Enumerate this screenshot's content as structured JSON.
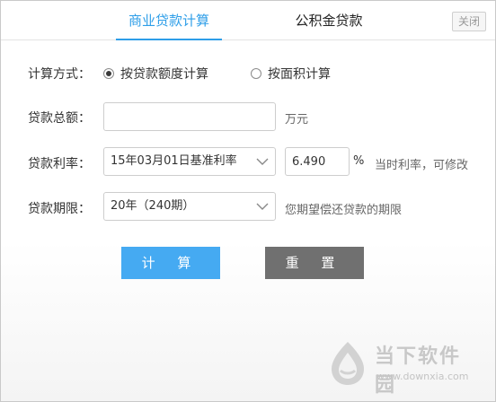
{
  "tabs": [
    {
      "label": "商业贷款计算",
      "active": true
    },
    {
      "label": "公积金贷款",
      "active": false
    }
  ],
  "close_label": "关闭",
  "form": {
    "method": {
      "label": "计算方式：",
      "options": [
        {
          "label": "按贷款额度计算",
          "checked": true
        },
        {
          "label": "按面积计算",
          "checked": false
        }
      ]
    },
    "total": {
      "label": "贷款总额：",
      "value": "",
      "unit": "万元"
    },
    "rate": {
      "label": "贷款利率：",
      "selected": "15年03月01日基准利率",
      "value": "6.490",
      "unit": "%",
      "hint": "当时利率，可修改"
    },
    "term": {
      "label": "贷款期限：",
      "selected": "20年（240期）",
      "hint": "您期望偿还贷款的期限"
    }
  },
  "buttons": {
    "calc": "计 算",
    "reset": "重 置"
  },
  "watermark": {
    "title": "当下软件园",
    "url": "www.downxia.com"
  },
  "colors": {
    "accent": "#2e9ee8",
    "calc_button": "#45aaf2",
    "reset_button": "#707070"
  }
}
